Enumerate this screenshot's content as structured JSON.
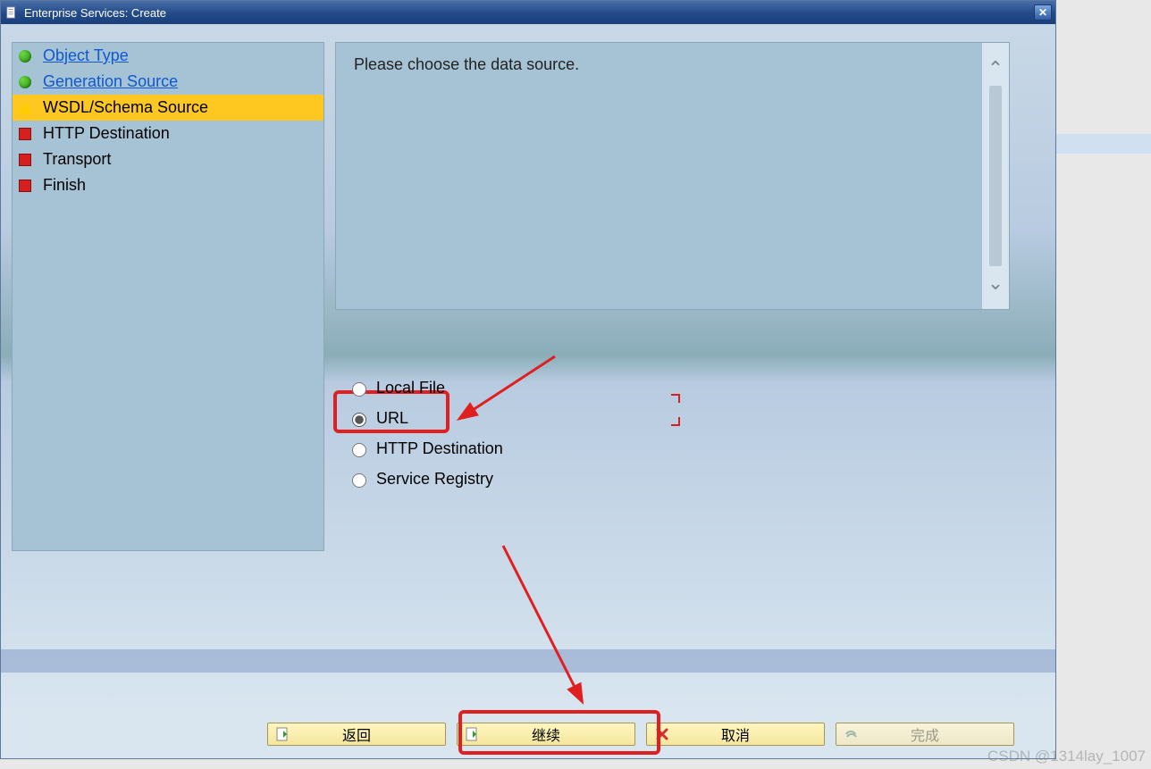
{
  "titlebar": {
    "title": "Enterprise Services: Create",
    "close_symbol": "✕"
  },
  "nav": {
    "items": [
      {
        "label": "Object Type",
        "status": "completed"
      },
      {
        "label": "Generation Source",
        "status": "completed"
      },
      {
        "label": "WSDL/Schema Source",
        "status": "active"
      },
      {
        "label": "HTTP Destination",
        "status": "pending"
      },
      {
        "label": "Transport",
        "status": "pending"
      },
      {
        "label": "Finish",
        "status": "pending"
      }
    ]
  },
  "instruction": {
    "text": "Please choose the data source."
  },
  "options": {
    "items": [
      {
        "label": "Local File",
        "selected": false
      },
      {
        "label": "URL",
        "selected": true
      },
      {
        "label": "HTTP Destination",
        "selected": false
      },
      {
        "label": "Service Registry",
        "selected": false
      }
    ]
  },
  "buttons": {
    "back": "返回",
    "continue": "继续",
    "cancel": "取消",
    "finish": "完成"
  },
  "watermark": "CSDN @1314lay_1007"
}
